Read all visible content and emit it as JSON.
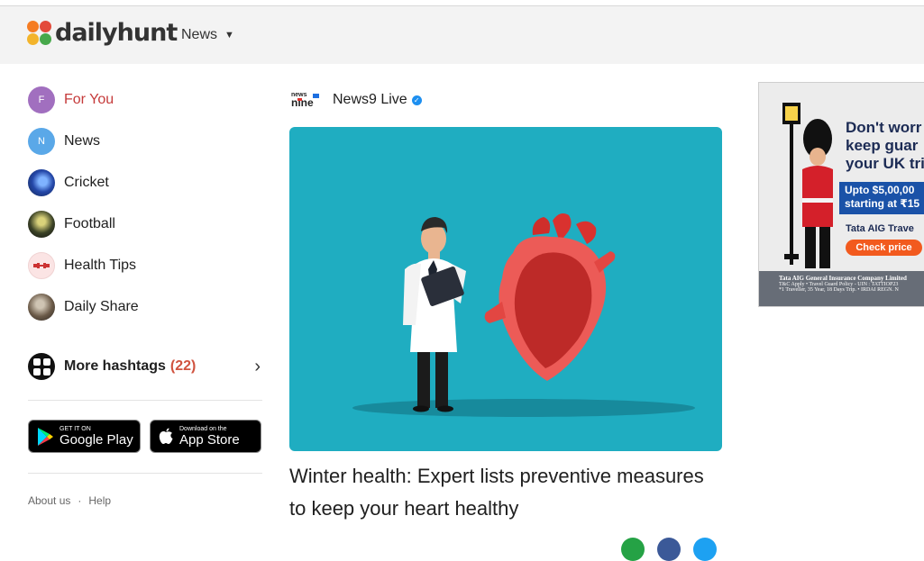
{
  "header": {
    "logo_text": "dailyhunt",
    "nav_label": "News",
    "nav_caret": "▼"
  },
  "colors": {
    "accent": "#c53a3a",
    "count": "#d0533f",
    "hero_bg": "#1fadc1"
  },
  "sidebar": {
    "items": [
      {
        "label": "For You",
        "avatar": "F",
        "color": "#a16fbf",
        "active": true
      },
      {
        "label": "News",
        "avatar": "N",
        "color": "#5aa8e8"
      },
      {
        "label": "Cricket",
        "avatar": "",
        "icon": "cricket-thumbnail",
        "color": "#2447a8"
      },
      {
        "label": "Football",
        "avatar": "",
        "icon": "football-thumbnail",
        "color": "#3b4226"
      },
      {
        "label": "Health Tips",
        "avatar": "",
        "icon": "health-tips-thumbnail",
        "color": "#fbe4e4"
      },
      {
        "label": "Daily Share",
        "avatar": "",
        "icon": "daily-share-thumbnail",
        "color": "#6b5a48"
      }
    ],
    "more": {
      "label": "More hashtags",
      "count": "(22)",
      "chevron": "›"
    },
    "stores": {
      "google": {
        "small": "GET IT ON",
        "big": "Google Play"
      },
      "apple": {
        "small": "Download on the",
        "big": "App Store"
      }
    },
    "footer": {
      "about": "About us",
      "sep": "·",
      "help": "Help"
    }
  },
  "article": {
    "publisher": "News9 Live",
    "publisher_logo_top": "news",
    "publisher_logo_bottom": "nine",
    "verified_mark": "✓",
    "title": "Winter health: Expert lists preventive measures to keep your heart healthy"
  },
  "ad": {
    "headline": [
      "Don't worr",
      "keep guar",
      "your UK tri"
    ],
    "band": [
      "Upto $5,00,00",
      "starting at ₹15"
    ],
    "brand": "Tata AIG Trave",
    "cta": "Check price",
    "footer_a": "Tata AIG General Insurance Company Limited",
    "footer_b": "T&C Apply • Travel Guard Policy - UIN : TATTIOP23",
    "footer_c": "*1 Traveller, 35 Year, 18 Days Trip. • IRDAI REGN. N"
  }
}
